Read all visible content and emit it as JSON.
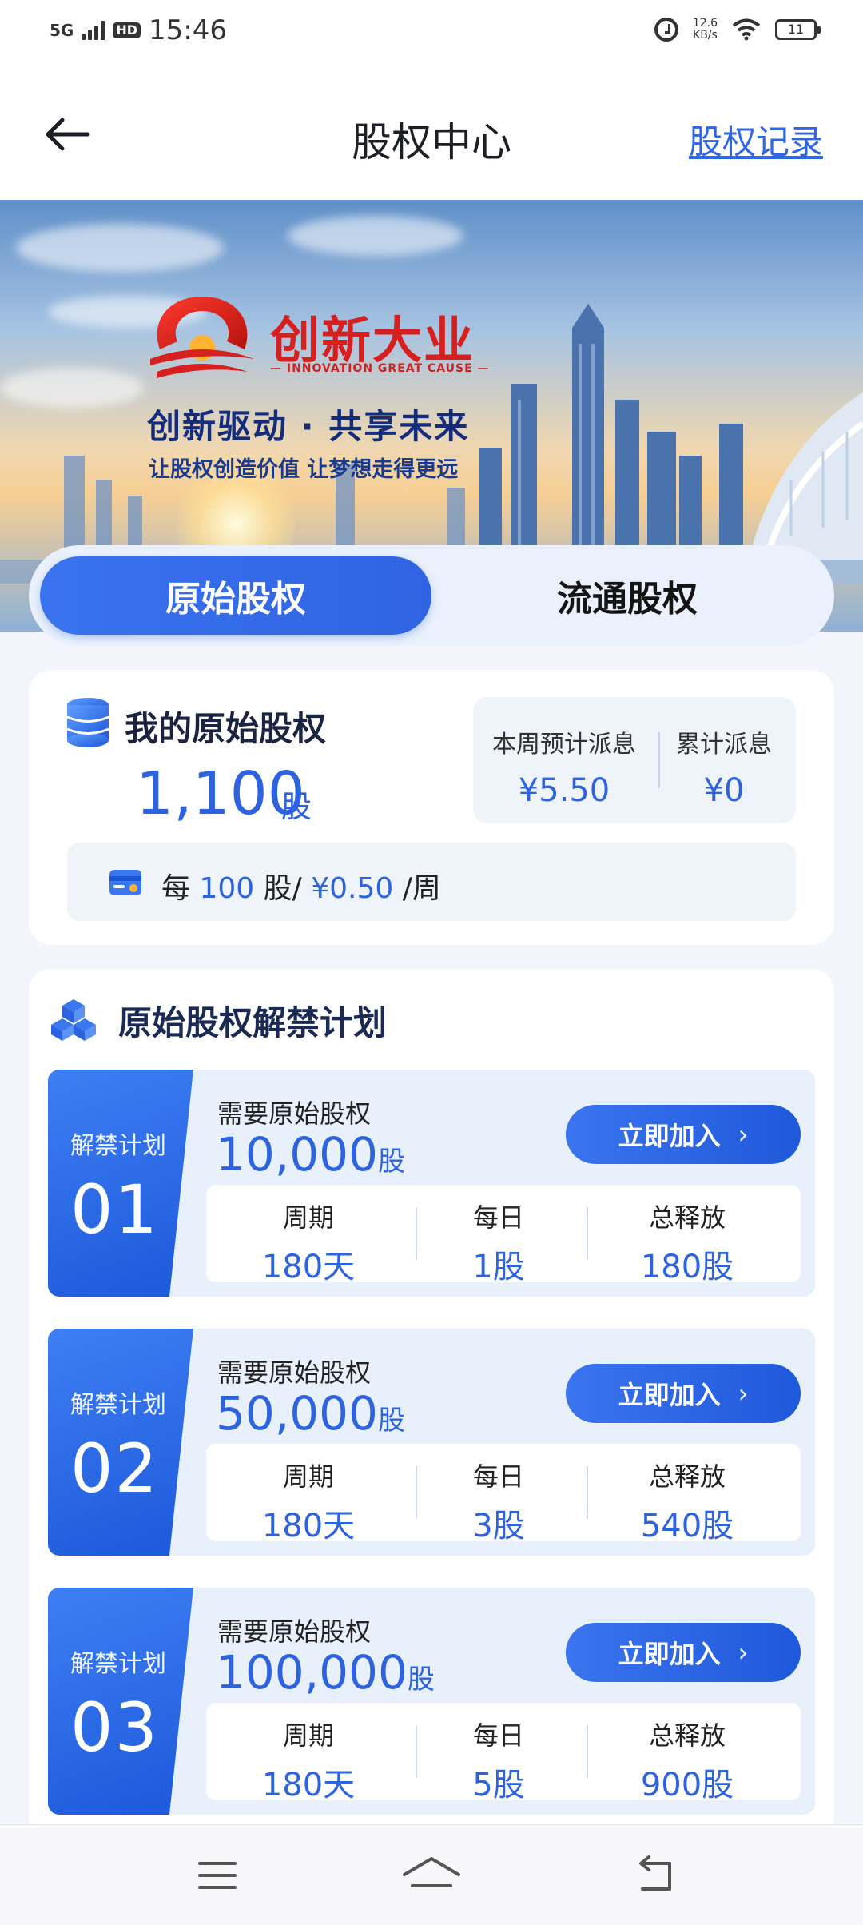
{
  "status_bar": {
    "network": "5G",
    "hd": "HD",
    "time": "15:46",
    "speed_value": "12.6",
    "speed_unit": "KB/s",
    "battery": "11"
  },
  "header": {
    "title": "股权中心",
    "records_link": "股权记录"
  },
  "banner": {
    "brand_cn": "创新大业",
    "brand_en": "— INNOVATION GREAT CAUSE —",
    "slogan": "创新驱动 · 共享未来",
    "subslogan": "让股权创造价值  让梦想走得更远"
  },
  "tabs": [
    {
      "label": "原始股权",
      "active": true
    },
    {
      "label": "流通股权",
      "active": false
    }
  ],
  "my_equity": {
    "title": "我的原始股权",
    "amount": "1,100",
    "unit": "股",
    "weekly_label": "本周预计派息",
    "weekly_value": "¥5.50",
    "total_label": "累计派息",
    "total_value": "¥0",
    "rate": {
      "prefix": "每",
      "shares": "100",
      "shares_unit": "股/",
      "amount": "¥0.50",
      "suffix": "/周"
    }
  },
  "plan_section": {
    "title": "原始股权解禁计划",
    "plans": [
      {
        "badge_label": "解禁计划",
        "number": "01",
        "need_label": "需要原始股权",
        "need_value": "10,000",
        "need_unit": "股",
        "button": "立即加入",
        "period_label": "周期",
        "period_value": "180天",
        "daily_label": "每日",
        "daily_value": "1股",
        "total_label": "总释放",
        "total_value": "180股"
      },
      {
        "badge_label": "解禁计划",
        "number": "02",
        "need_label": "需要原始股权",
        "need_value": "50,000",
        "need_unit": "股",
        "button": "立即加入",
        "period_label": "周期",
        "period_value": "180天",
        "daily_label": "每日",
        "daily_value": "3股",
        "total_label": "总释放",
        "total_value": "540股"
      },
      {
        "badge_label": "解禁计划",
        "number": "03",
        "need_label": "需要原始股权",
        "need_value": "100,000",
        "need_unit": "股",
        "button": "立即加入",
        "period_label": "周期",
        "period_value": "180天",
        "daily_label": "每日",
        "daily_value": "5股",
        "total_label": "总释放",
        "total_value": "900股"
      }
    ]
  },
  "colors": {
    "accent": "#2e63e0",
    "brand_red": "#d61f1f",
    "background": "#f2f6fc"
  }
}
